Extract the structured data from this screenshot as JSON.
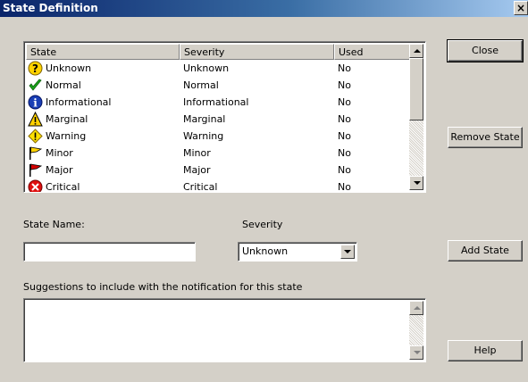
{
  "window": {
    "title": "State Definition",
    "close_glyph": "×"
  },
  "list": {
    "columns": [
      "State",
      "Severity",
      "Used"
    ],
    "rows": [
      {
        "icon": "question-icon",
        "state": "Unknown",
        "severity": "Unknown",
        "used": "No"
      },
      {
        "icon": "checkmark-icon",
        "state": "Normal",
        "severity": "Normal",
        "used": "No"
      },
      {
        "icon": "info-icon",
        "state": "Informational",
        "severity": "Informational",
        "used": "No"
      },
      {
        "icon": "warning-triangle-icon",
        "state": "Marginal",
        "severity": "Marginal",
        "used": "No"
      },
      {
        "icon": "warning-diamond-icon",
        "state": "Warning",
        "severity": "Warning",
        "used": "No"
      },
      {
        "icon": "yellow-flag-icon",
        "state": "Minor",
        "severity": "Minor",
        "used": "No"
      },
      {
        "icon": "red-flag-icon",
        "state": "Major",
        "severity": "Major",
        "used": "No"
      },
      {
        "icon": "critical-x-icon",
        "state": "Critical",
        "severity": "Critical",
        "used": "No"
      }
    ]
  },
  "buttons": {
    "close": "Close",
    "remove_state": "Remove State",
    "add_state": "Add State",
    "help": "Help"
  },
  "form": {
    "state_name_label": "State Name:",
    "state_name_value": "",
    "severity_label": "Severity",
    "severity_selected": "Unknown",
    "suggestions_label": "Suggestions to include with the notification for this state",
    "suggestions_value": ""
  },
  "colors": {
    "titlebar_start": "#0a246a",
    "titlebar_end": "#a6caf0",
    "face": "#d4d0c8"
  }
}
